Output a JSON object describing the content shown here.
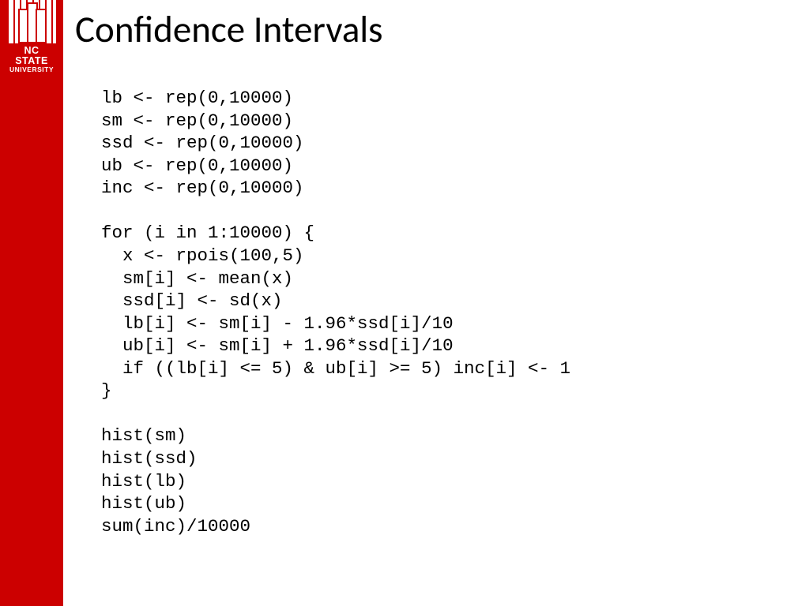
{
  "brand": {
    "line1": "NC STATE",
    "line2": "UNIVERSITY",
    "color": "#cc0000"
  },
  "slide": {
    "title": "Confidence Intervals",
    "code": "lb <- rep(0,10000)\nsm <- rep(0,10000)\nssd <- rep(0,10000)\nub <- rep(0,10000)\ninc <- rep(0,10000)\n\nfor (i in 1:10000) {\n  x <- rpois(100,5)\n  sm[i] <- mean(x)\n  ssd[i] <- sd(x)\n  lb[i] <- sm[i] - 1.96*ssd[i]/10\n  ub[i] <- sm[i] + 1.96*ssd[i]/10\n  if ((lb[i] <= 5) & ub[i] >= 5) inc[i] <- 1\n}\n\nhist(sm)\nhist(ssd)\nhist(lb)\nhist(ub)\nsum(inc)/10000"
  }
}
